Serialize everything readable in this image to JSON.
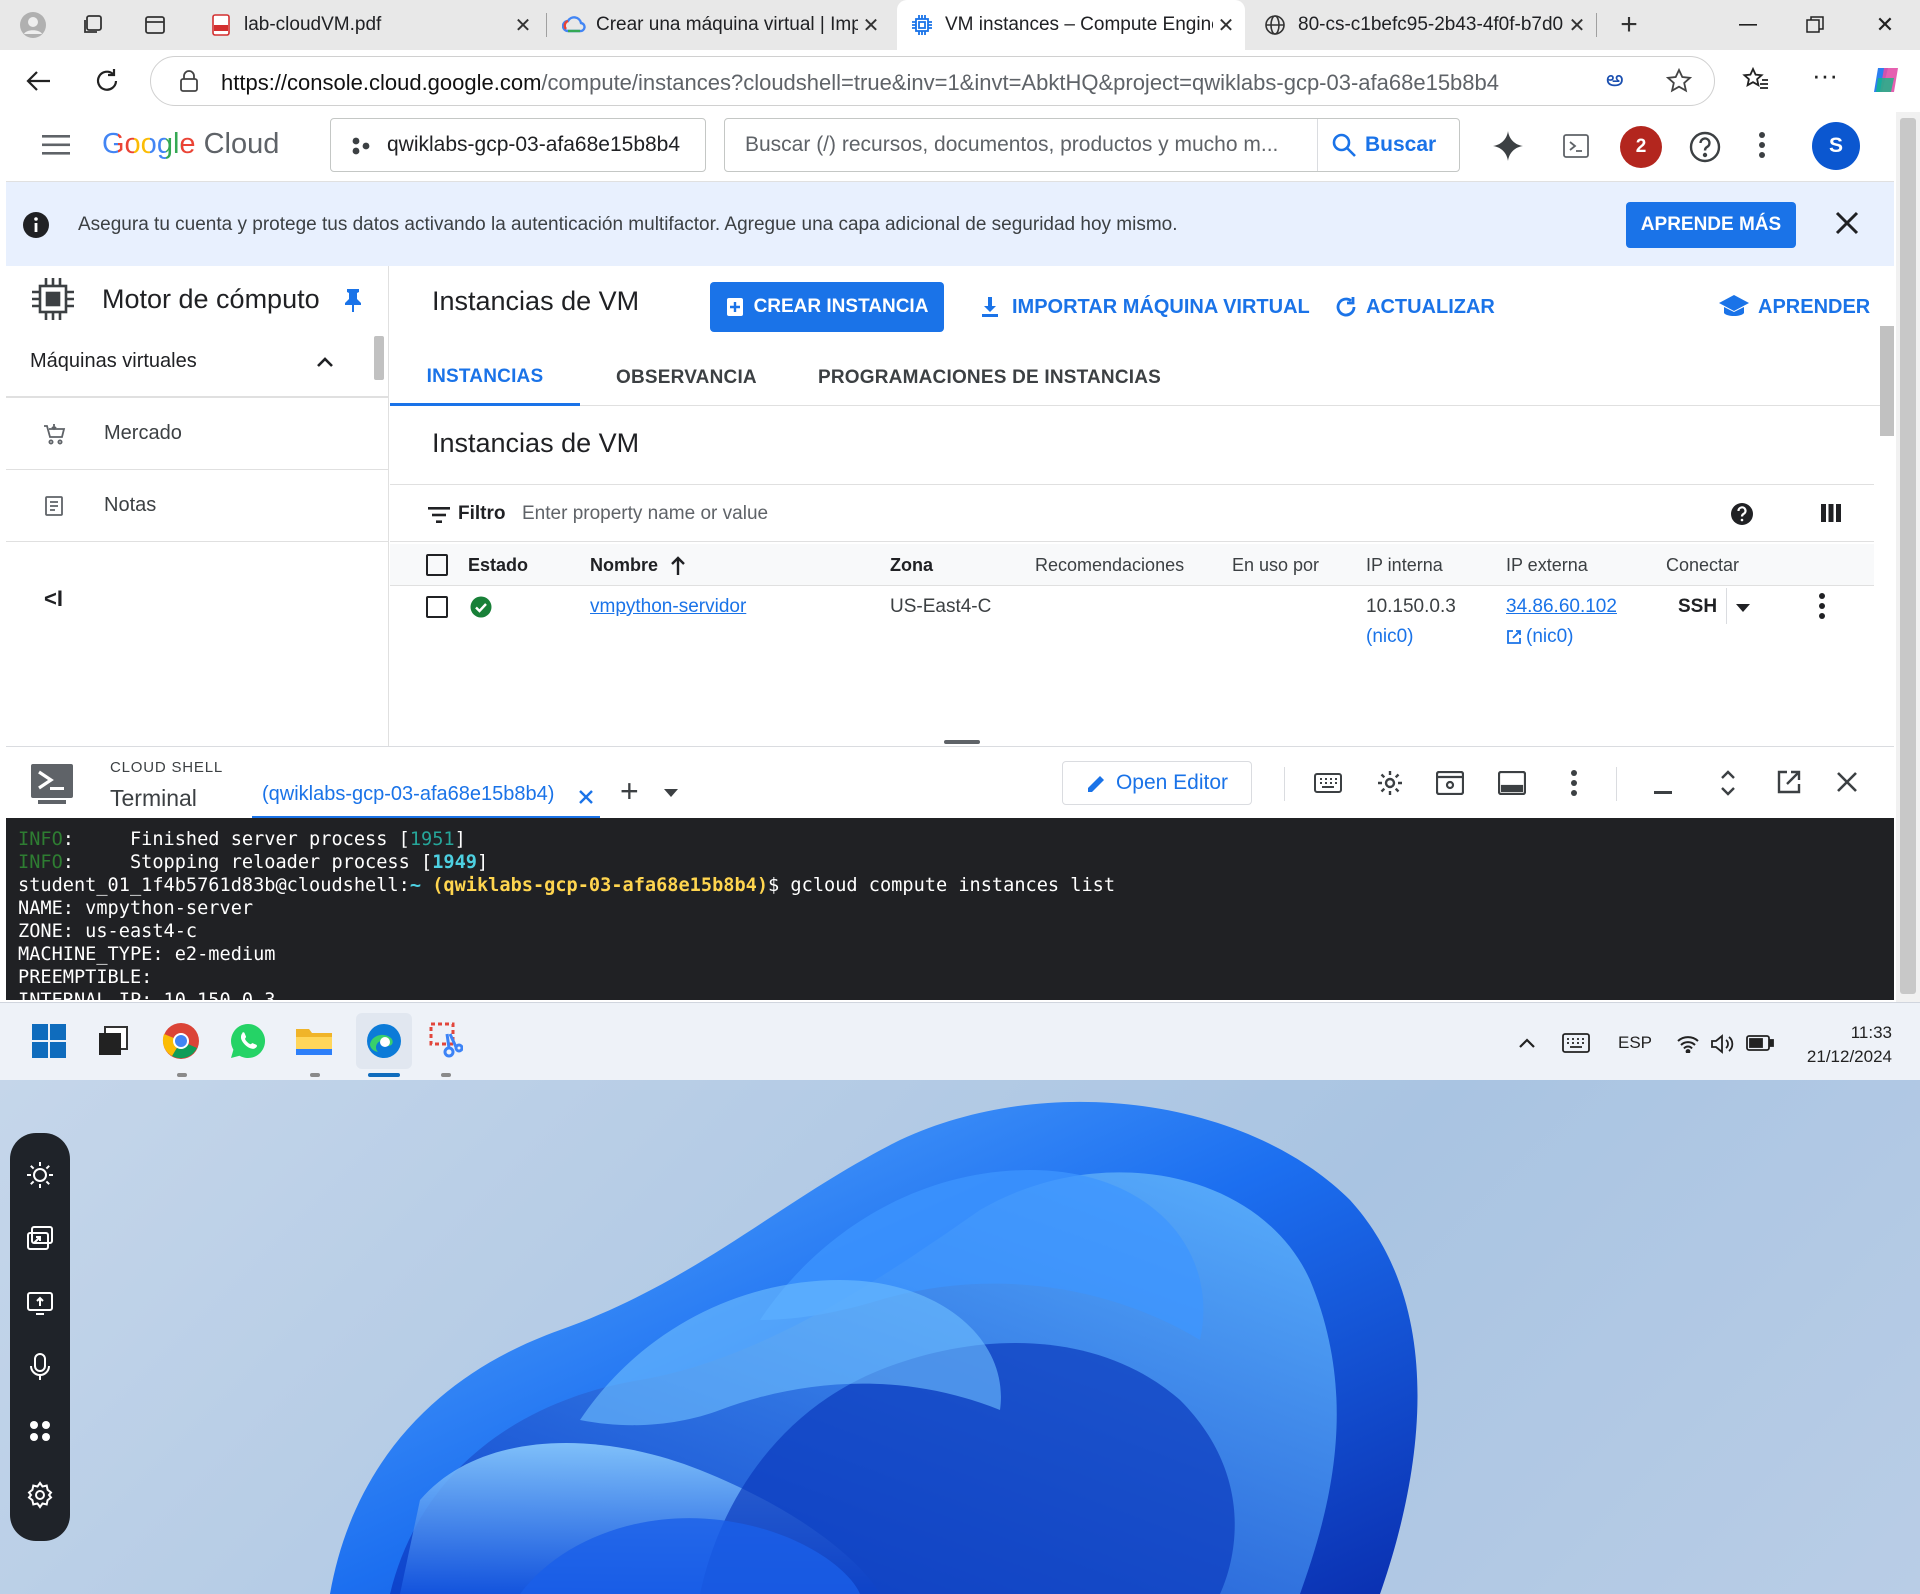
{
  "browser": {
    "tabs": [
      {
        "title": "lab-cloudVM.pdf",
        "icon": "pdf-icon",
        "active": false
      },
      {
        "title": "Crear una máquina virtual | Impu",
        "icon": "google-cloud-icon",
        "active": false
      },
      {
        "title": "VM instances – Compute Engine",
        "icon": "compute-engine-icon",
        "active": true
      },
      {
        "title": "80-cs-c1befc95-2b43-4f0f-b7d0",
        "icon": "globe-icon",
        "active": false
      }
    ],
    "url_host": "https://console.cloud.google.com",
    "url_path": "/compute/instances?cloudshell=true&inv=1&invt=AbktHQ&project=qwiklabs-gcp-03-afa68e15b8b4"
  },
  "console": {
    "logo_google": "Google",
    "logo_cloud": "Cloud",
    "project": "qwiklabs-gcp-03-afa68e15b8b4",
    "search_placeholder": "Buscar (/) recursos, documentos, productos y mucho m...",
    "search_button": "Buscar",
    "notification_count": "2",
    "avatar_letter": "S",
    "banner_text": "Asegura tu cuenta y protege tus datos activando la autenticación multifactor. Agregue una capa adicional de seguridad hoy mismo.",
    "banner_button": "APRENDE MÁS",
    "nav_title": "Motor de cómputo",
    "nav_section": "Máquinas virtuales",
    "nav_items": [
      "Mercado",
      "Notas"
    ],
    "page_title": "Instancias de VM",
    "toolbar": {
      "create": "CREAR INSTANCIA",
      "import": "IMPORTAR MÁQUINA VIRTUAL",
      "refresh": "ACTUALIZAR",
      "learn": "APRENDER"
    },
    "tabs": [
      "INSTANCIAS",
      "OBSERVANCIA",
      "PROGRAMACIONES DE INSTANCIAS"
    ],
    "section_title": "Instancias de VM",
    "filter_label": "Filtro",
    "filter_placeholder": "Enter property name or value",
    "table": {
      "headers": [
        "Estado",
        "Nombre",
        "Zona",
        "Recomendaciones",
        "En uso por",
        "IP interna",
        "IP externa",
        "Conectar"
      ],
      "rows": [
        {
          "status": "running",
          "name": "vmpython-servidor",
          "zone": "US-East4-C",
          "internal_ip": "10.150.0.3",
          "internal_nic": "(nic0)",
          "external_ip": "34.86.60.102",
          "external_nic": "(nic0)",
          "connect": "SSH"
        }
      ]
    }
  },
  "cloudshell": {
    "label": "CLOUD SHELL",
    "title": "Terminal",
    "tab": "(qwiklabs-gcp-03-afa68e15b8b4)",
    "open_editor": "Open Editor",
    "lines": [
      [
        {
          "t": "INFO",
          "c": "g"
        },
        {
          "t": ":     Finished server process ["
        },
        {
          "t": "1951",
          "c": "c"
        },
        {
          "t": "]"
        }
      ],
      [
        {
          "t": "INFO",
          "c": "g"
        },
        {
          "t": ":     Stopping reloader process ["
        },
        {
          "t": "1949",
          "c": "cb"
        },
        {
          "t": "]"
        }
      ],
      [
        {
          "t": "student_01_1f4b5761d83b@cloudshell:"
        },
        {
          "t": "~ ",
          "c": "cb"
        },
        {
          "t": "(qwiklabs-gcp-03-afa68e15b8b4)",
          "c": "y"
        },
        {
          "t": "$ gcloud compute instances list"
        }
      ],
      [
        {
          "t": "NAME: vmpython-server"
        }
      ],
      [
        {
          "t": "ZONE: us-east4-c"
        }
      ],
      [
        {
          "t": "MACHINE_TYPE: e2-medium"
        }
      ],
      [
        {
          "t": "PREEMPTIBLE:"
        }
      ],
      [
        {
          "t": "INTERNAL_IP: 10.150.0.3"
        }
      ],
      [
        {
          "t": "EXTERNAL_IP: 34.86.60.102"
        }
      ],
      [
        {
          "t": "STATUS: RUNNING"
        }
      ],
      [
        {
          "t": "student_01_1f4b5761d83b@cloudshell:"
        },
        {
          "t": "~ ",
          "c": "cb"
        },
        {
          "t": "(qwiklabs-gcp-03-afa68e15b8b4)",
          "c": "y"
        },
        {
          "t": "$ "
        }
      ]
    ]
  },
  "taskbar": {
    "language": "ESP",
    "time": "11:33",
    "date": "21/12/2024"
  }
}
